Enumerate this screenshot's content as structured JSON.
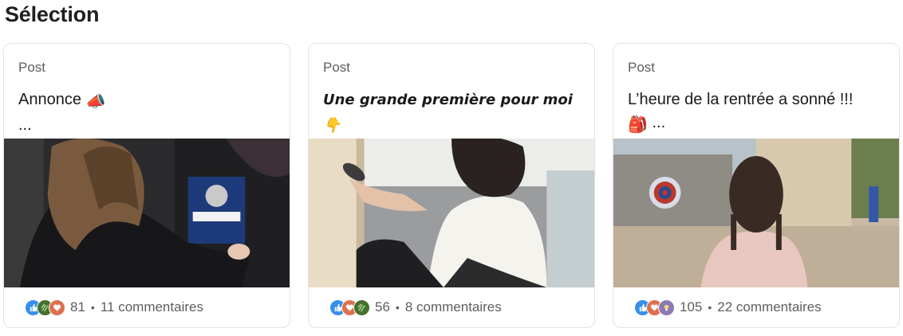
{
  "section": {
    "title": "Sélection"
  },
  "cards": [
    {
      "type": "Post",
      "text": "Annonce",
      "emoji": "📣",
      "ellipsis": "...",
      "reaction_count": "81",
      "comments": "11 commentaires",
      "reactions": [
        "like",
        "celebrate",
        "love"
      ]
    },
    {
      "type": "Post",
      "text": "Une grande première pour moi",
      "emoji": "👇",
      "ellipsis": "...",
      "reaction_count": "56",
      "comments": "8 commentaires",
      "reactions": [
        "like",
        "love",
        "celebrate"
      ]
    },
    {
      "type": "Post",
      "text": "L’heure de la rentrée a sonné !!!",
      "emoji": "🎒",
      "ellipsis": "...",
      "reaction_count": "105",
      "comments": "22 commentaires",
      "reactions": [
        "like",
        "love",
        "insightful"
      ]
    }
  ],
  "separator": "•",
  "colors": {
    "like": "#378fe9",
    "celebrate": "#44712e",
    "love": "#df704d",
    "insightful": "#8c7ab5"
  }
}
